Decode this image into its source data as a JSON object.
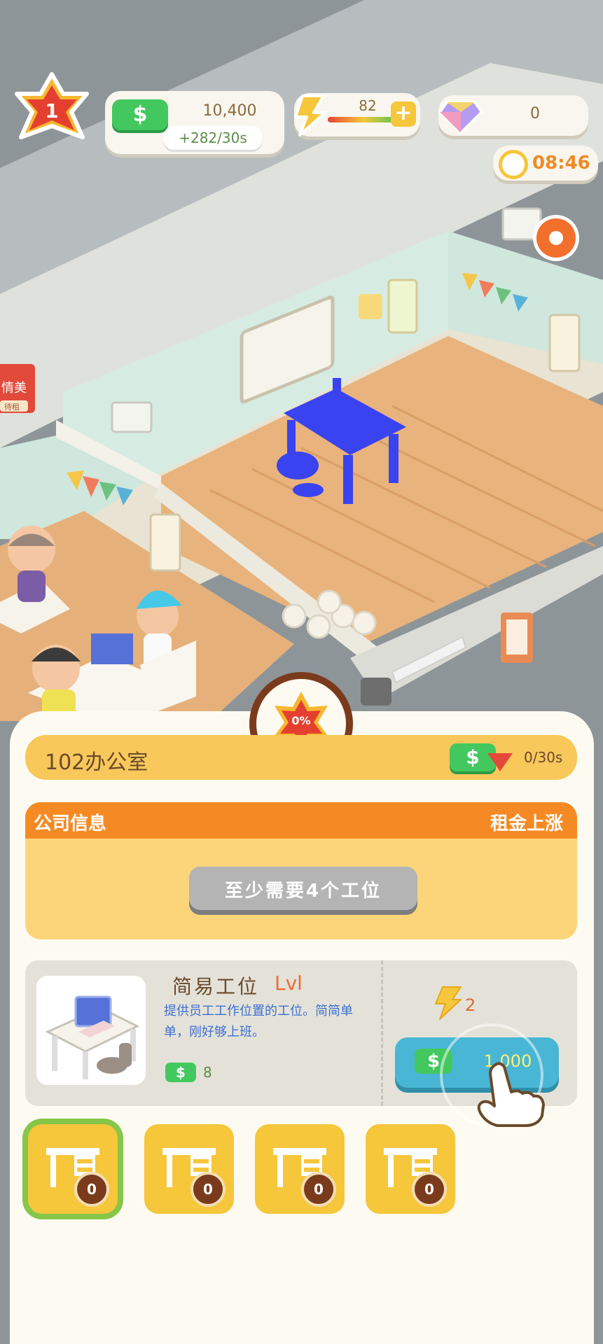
{
  "hud": {
    "level": "1",
    "cash_value": "10,400",
    "cash_rate": "+282/30s",
    "energy_value": "82",
    "gems_value": "0",
    "timer": "08:46"
  },
  "room": {
    "sign_text": "情美",
    "sign_sub": "待租"
  },
  "panel": {
    "progress_percent": "0%",
    "room_name": "102办公室",
    "income_text": "0/30s",
    "company_info_label": "公司信息",
    "rent_increase_label": "租金上涨",
    "requirement_text": "至少需要4个工位"
  },
  "item": {
    "title": "简易工位",
    "level": "Lvl",
    "description": "提供员工工作位置的工位。简简单单，刚好够上班。",
    "income_value": "8",
    "energy_cost": "2",
    "buy_price": "1,000"
  },
  "slots": [
    {
      "count": "0",
      "selected": true
    },
    {
      "count": "0",
      "selected": false
    },
    {
      "count": "0",
      "selected": false
    },
    {
      "count": "0",
      "selected": false
    }
  ],
  "colors": {
    "accent_orange": "#f58a24",
    "accent_yellow": "#f6c63b",
    "button_blue": "#48b6d4",
    "cash_green": "#43c85f",
    "panel_bg": "#fdfbf1"
  }
}
